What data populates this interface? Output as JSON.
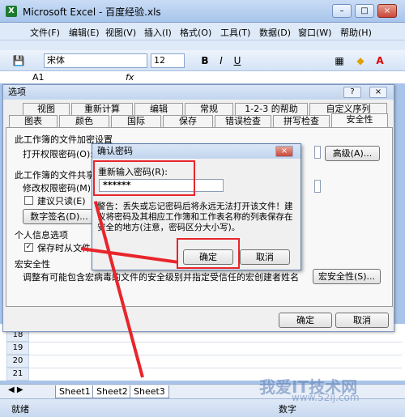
{
  "window": {
    "title": "Microsoft Excel - 百度经验.xls",
    "app_icon": "excel-icon"
  },
  "menu": {
    "items": [
      "文件(F)",
      "编辑(E)",
      "视图(V)",
      "插入(I)",
      "格式(O)",
      "工具(T)",
      "数据(D)",
      "窗口(W)",
      "帮助(H)"
    ]
  },
  "toolbar": {
    "font_name": "宋体",
    "font_size": "12",
    "bold": "B",
    "italic": "I",
    "underline": "U",
    "font_color_glyph": "A",
    "fx": "fx"
  },
  "formula_bar": {
    "cell_ref": "A1"
  },
  "options_dialog": {
    "title": "选项",
    "help_btn": "?",
    "close_btn": "×",
    "tabs_row1": [
      "视图",
      "重新计算",
      "编辑",
      "常规",
      "1-2-3 的帮助",
      "自定义序列"
    ],
    "tabs_row2": [
      "图表",
      "颜色",
      "国际",
      "保存",
      "错误检查",
      "拼写检查",
      "安全性"
    ],
    "active_tab": "安全性",
    "section1": "此工作簿的文件加密设置",
    "open_password_label": "打开权限密码(O):",
    "advanced_btn": "高级(A)...",
    "section2": "此工作簿的文件共享设置",
    "modify_password_label": "修改权限密码(M):",
    "readonly_label": "建议只读(E)",
    "digital_sign_btn": "数字签名(D)...",
    "section3": "个人信息选项",
    "remove_info_label": "保存时从文件属性",
    "section4": "宏安全性",
    "macro_desc": "调整有可能包含宏病毒的文件的安全级别并指定受信任的宏创建者姓名。",
    "macro_security_btn": "宏安全性(S)...",
    "ok_btn": "确定",
    "cancel_btn": "取消"
  },
  "confirm_dialog": {
    "title": "确认密码",
    "close_btn": "×",
    "reenter_label": "重新输入密码(R):",
    "password_value": "******",
    "warning": "警告：丢失或忘记密码后将永远无法打开该文件！建议将密码及其相应工作簿和工作表名称的列表保存在安全的地方(注意，密码区分大小写)。",
    "ok_btn": "确定",
    "cancel_btn": "取消"
  },
  "sheet": {
    "rows": [
      "18",
      "19",
      "20",
      "21",
      "22",
      "23"
    ],
    "tabs": [
      "Sheet1",
      "Sheet2",
      "Sheet3"
    ]
  },
  "status": {
    "left": "就绪",
    "right": "数字"
  },
  "watermark": {
    "line1": "我爱IT技术网",
    "line2": "www.52ij.com"
  },
  "colors": {
    "highlight_red": "#e8252b"
  }
}
